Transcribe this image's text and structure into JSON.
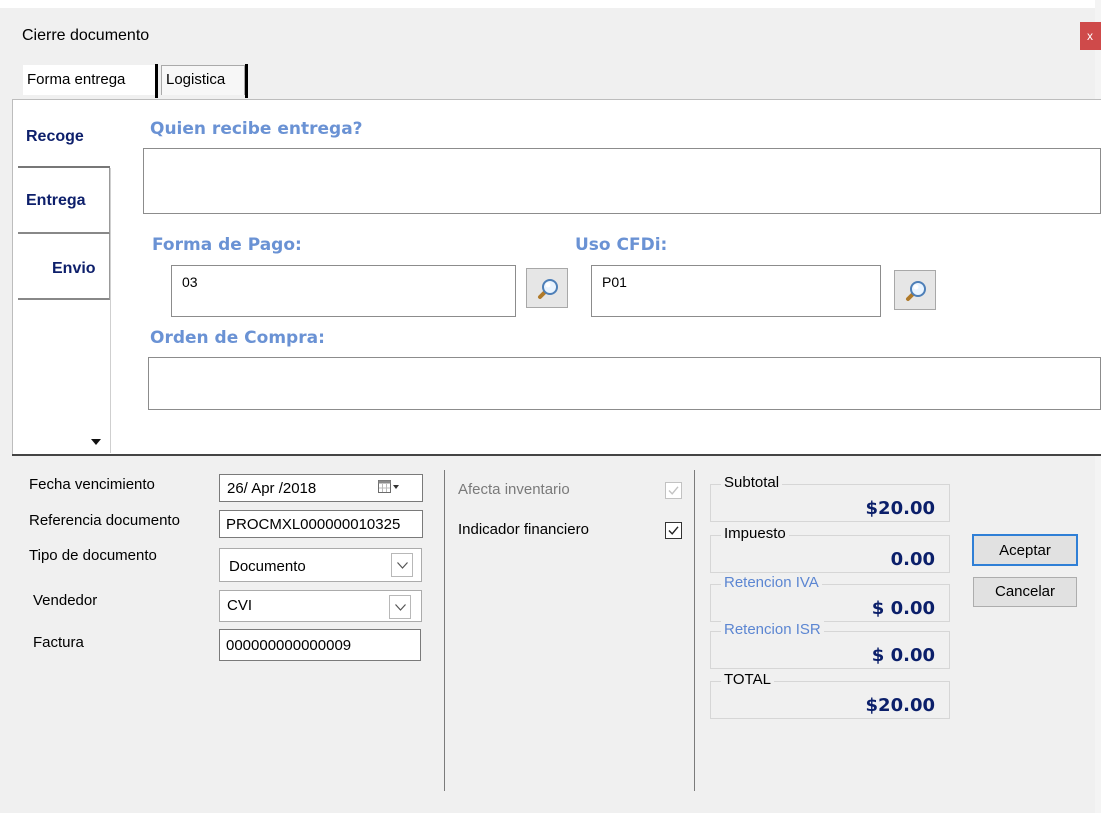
{
  "window": {
    "title": "Cierre documento",
    "close_label": "x"
  },
  "tabs": [
    {
      "label": "Forma entrega",
      "selected": true
    },
    {
      "label": "Logistica",
      "selected": false
    }
  ],
  "side_tabs": [
    {
      "label": "Recoge",
      "selected": true
    },
    {
      "label": "Entrega",
      "selected": false
    },
    {
      "label": "Envio",
      "selected": false
    }
  ],
  "form": {
    "quien_label": "Quien recibe entrega?",
    "quien_value": "",
    "forma_pago_label": "Forma de Pago:",
    "forma_pago_value": "03",
    "uso_cfdi_label": "Uso CFDi:",
    "uso_cfdi_value": "P01",
    "orden_label": "Orden de Compra:",
    "orden_value": ""
  },
  "details": {
    "fecha_label": "Fecha vencimiento",
    "fecha_value": "26/ Apr /2018",
    "referencia_label": "Referencia documento",
    "referencia_value": "PROCMXL000000010325",
    "tipo_label": "Tipo de documento",
    "tipo_value": "Documento",
    "vendedor_label": "Vendedor",
    "vendedor_value": "CVI",
    "factura_label": "Factura",
    "factura_value": "000000000000009"
  },
  "flags": {
    "afecta_label": "Afecta inventario",
    "afecta_checked": true,
    "afecta_enabled": false,
    "indicador_label": "Indicador financiero",
    "indicador_checked": true
  },
  "totals": {
    "subtotal_label": "Subtotal",
    "subtotal_value": "$20.00",
    "impuesto_label": "Impuesto",
    "impuesto_value": "0.00",
    "ret_iva_label": "Retencion IVA",
    "ret_iva_value": "$ 0.00",
    "ret_isr_label": "Retencion ISR",
    "ret_isr_value": "$ 0.00",
    "total_label": "TOTAL",
    "total_value": "$20.00"
  },
  "buttons": {
    "accept": "Aceptar",
    "cancel": "Cancelar"
  },
  "colors": {
    "label_blue": "#6a92d4",
    "value_navy": "#0b1f6a",
    "close_red": "#cf4a4a",
    "accept_border": "#2f7fd6"
  },
  "icons": [
    "search-icon",
    "calendar-icon",
    "chevron-down-icon",
    "check-icon",
    "close-icon",
    "scroll-down-icon"
  ]
}
